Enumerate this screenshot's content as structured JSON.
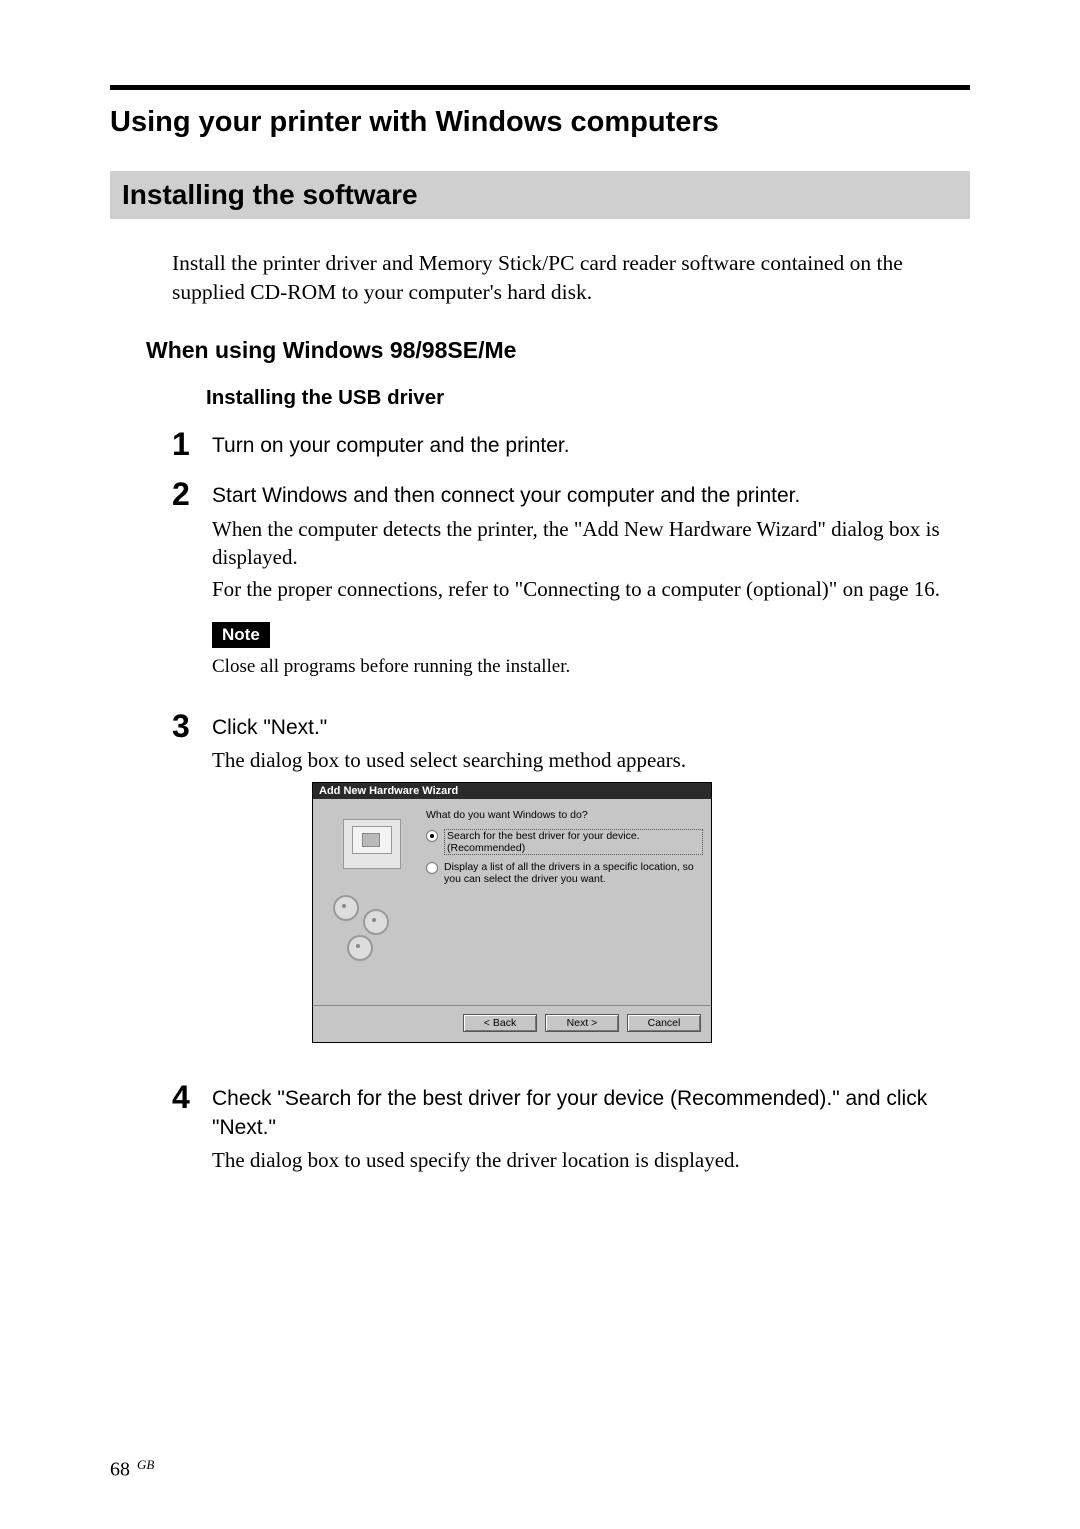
{
  "h1": "Using your printer with Windows computers",
  "h2": "Installing the software",
  "intro": "Install the printer driver and Memory Stick/PC card reader software contained on the supplied CD-ROM to your computer's hard disk.",
  "h3": "When using Windows 98/98SE/Me",
  "h4": "Installing the USB driver",
  "steps": {
    "1": {
      "num": "1",
      "bold": "Turn on your computer and the printer."
    },
    "2": {
      "num": "2",
      "bold": "Start Windows and then connect your computer and the printer.",
      "p1": "When the computer detects the printer, the \"Add New Hardware Wizard\" dialog box is displayed.",
      "p2": "For the proper connections, refer to \"Connecting to a computer (optional)\" on page 16.",
      "note_label": "Note",
      "note_text": "Close all programs before running the installer."
    },
    "3": {
      "num": "3",
      "bold": "Click \"Next.\"",
      "p1": "The dialog box to used select searching method appears."
    },
    "4": {
      "num": "4",
      "bold": "Check \"Search for the best driver for your device (Recommended).\" and click \"Next.\"",
      "p1": "The dialog box to used specify the driver location is displayed."
    }
  },
  "wizard": {
    "title": "Add New Hardware Wizard",
    "question": "What do you want Windows to do?",
    "opt1": "Search for the best driver for your device. (Recommended)",
    "opt2": "Display a list of all the drivers in a specific location, so you can select the driver you want.",
    "btn_back": "< Back",
    "btn_next": "Next >",
    "btn_cancel": "Cancel"
  },
  "footer": {
    "page": "68",
    "region": "GB"
  }
}
